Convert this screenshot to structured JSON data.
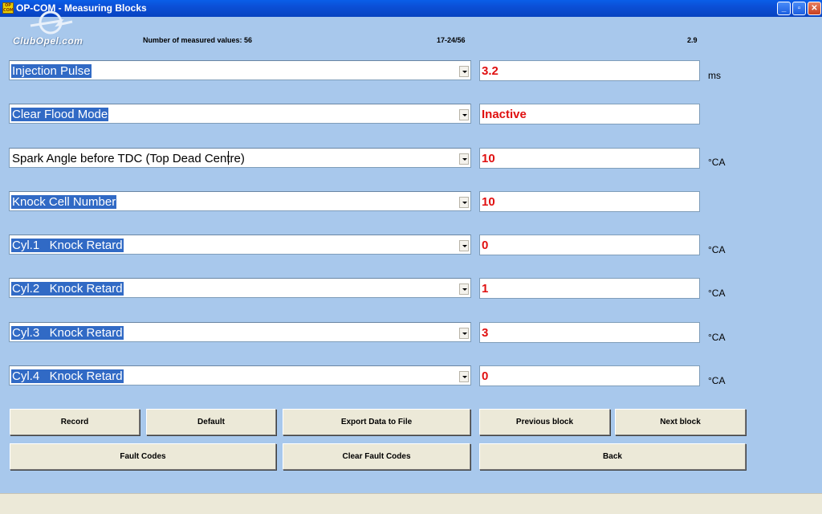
{
  "window": {
    "icon_text": "OP COM",
    "title": "OP-COM - Measuring Blocks",
    "controls": {
      "minimize": "_",
      "maximize": "▫",
      "close": "✕"
    }
  },
  "logo": {
    "text": "ClubOpel.com"
  },
  "header": {
    "count_label": "Number of measured values: 56",
    "range": "17-24/56",
    "version": "2.9"
  },
  "rows": [
    {
      "label": "Injection Pulse",
      "value": "3.2",
      "unit": "ms"
    },
    {
      "label": "Clear Flood Mode",
      "value": "Inactive",
      "unit": ""
    },
    {
      "label": "Spark Angle before TDC (Top Dead Centre)",
      "value": "10",
      "unit": "°CA"
    },
    {
      "label": "Knock Cell Number",
      "value": "10",
      "unit": ""
    },
    {
      "label": "Cyl.1   Knock Retard",
      "value": "0",
      "unit": "°CA"
    },
    {
      "label": "Cyl.2   Knock Retard",
      "value": "1",
      "unit": "°CA"
    },
    {
      "label": "Cyl.3   Knock Retard",
      "value": "3",
      "unit": "°CA"
    },
    {
      "label": "Cyl.4   Knock Retard",
      "value": "0",
      "unit": "°CA"
    }
  ],
  "buttons": {
    "record": "Record",
    "default": "Default",
    "export": "Export Data to File",
    "previous": "Previous block",
    "next": "Next block",
    "fault_codes": "Fault Codes",
    "clear_fault_codes": "Clear Fault Codes",
    "back": "Back"
  },
  "colors": {
    "background": "#a8c8ec",
    "selection": "#316ac5",
    "value_text": "#e01010",
    "button_face": "#ece9d8"
  }
}
